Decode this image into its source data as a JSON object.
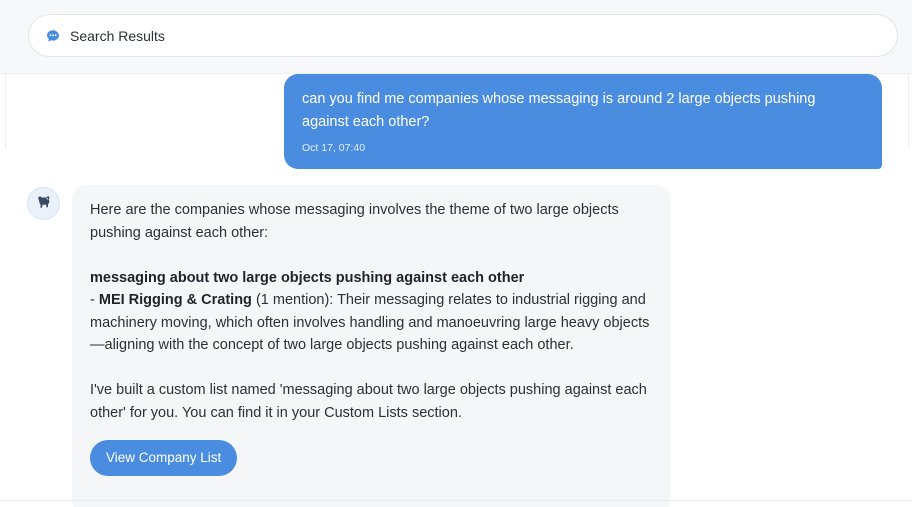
{
  "header": {
    "search_label": "Search Results",
    "icon": "chat-bubble-icon"
  },
  "user_message": {
    "text": "can you find me companies whose messaging is around 2 large objects pushing against each other?",
    "timestamp": "Oct 17, 07:40"
  },
  "assistant_message": {
    "avatar_icon": "dog-icon",
    "intro": "Here are the companies whose messaging involves the theme of two large objects pushing against each other:",
    "section_heading": "messaging about two large objects pushing against each other",
    "item_prefix": "- ",
    "company_name": "MEI Rigging & Crating",
    "mention_count": "(1 mention)",
    "item_description": ": Their messaging relates to industrial rigging and machinery moving, which often involves handling and manoeuvring large heavy objects—aligning with the concept of two large objects pushing against each other.",
    "list_note": "I've built a custom list named 'messaging about two large objects pushing against each other' for you. You can find it in your Custom Lists section.",
    "button_label": "View Company List"
  },
  "colors": {
    "accent": "#4a8de0",
    "bubble_bg": "#f5f6f8",
    "header_bg": "#f7f8fa"
  }
}
